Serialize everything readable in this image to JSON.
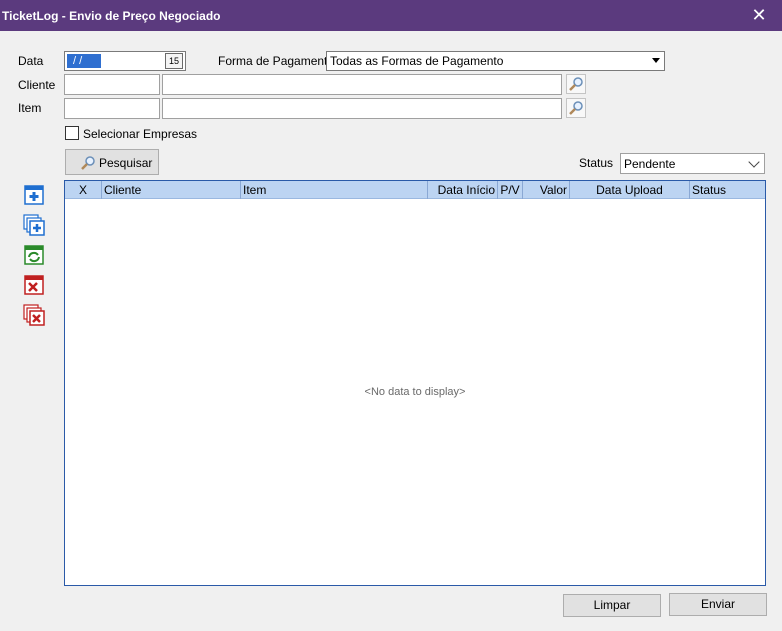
{
  "window": {
    "title": "TicketLog - Envio de Preço Negociado",
    "close_glyph": "✕"
  },
  "form": {
    "data_label": "Data",
    "data_value": "/ /",
    "calendar_glyph": "15",
    "forma_pagamento_label": "Forma de Pagamento",
    "forma_pagamento_value": "Todas as Formas de Pagamento",
    "cliente_label": "Cliente",
    "cliente_code": "",
    "cliente_name": "",
    "item_label": "Item",
    "item_code": "",
    "item_name": "",
    "selecionar_empresas_label": "Selecionar Empresas",
    "selecionar_empresas_checked": false,
    "pesquisar_label": "Pesquisar",
    "status_label": "Status",
    "status_value": "Pendente"
  },
  "grid": {
    "columns": [
      "X",
      "Cliente",
      "Item",
      "Data Início",
      "P/V",
      "Valor",
      "Data Upload",
      "Status"
    ],
    "rows": [],
    "empty_text": "<No data to display>"
  },
  "sidebar": {
    "buttons": [
      {
        "name": "add-icon",
        "color": "#1f6fd0"
      },
      {
        "name": "add-multiple-icon",
        "color": "#1f6fd0"
      },
      {
        "name": "refresh-icon",
        "color": "#2a8a2a"
      },
      {
        "name": "delete-icon",
        "color": "#c02020"
      },
      {
        "name": "delete-multiple-icon",
        "color": "#c02020"
      }
    ]
  },
  "footer": {
    "limpar_label": "Limpar",
    "enviar_label": "Enviar"
  },
  "colors": {
    "titlebar": "#5b3a7e",
    "grid_header": "#bcd4f2",
    "grid_border": "#2a5aa8"
  }
}
